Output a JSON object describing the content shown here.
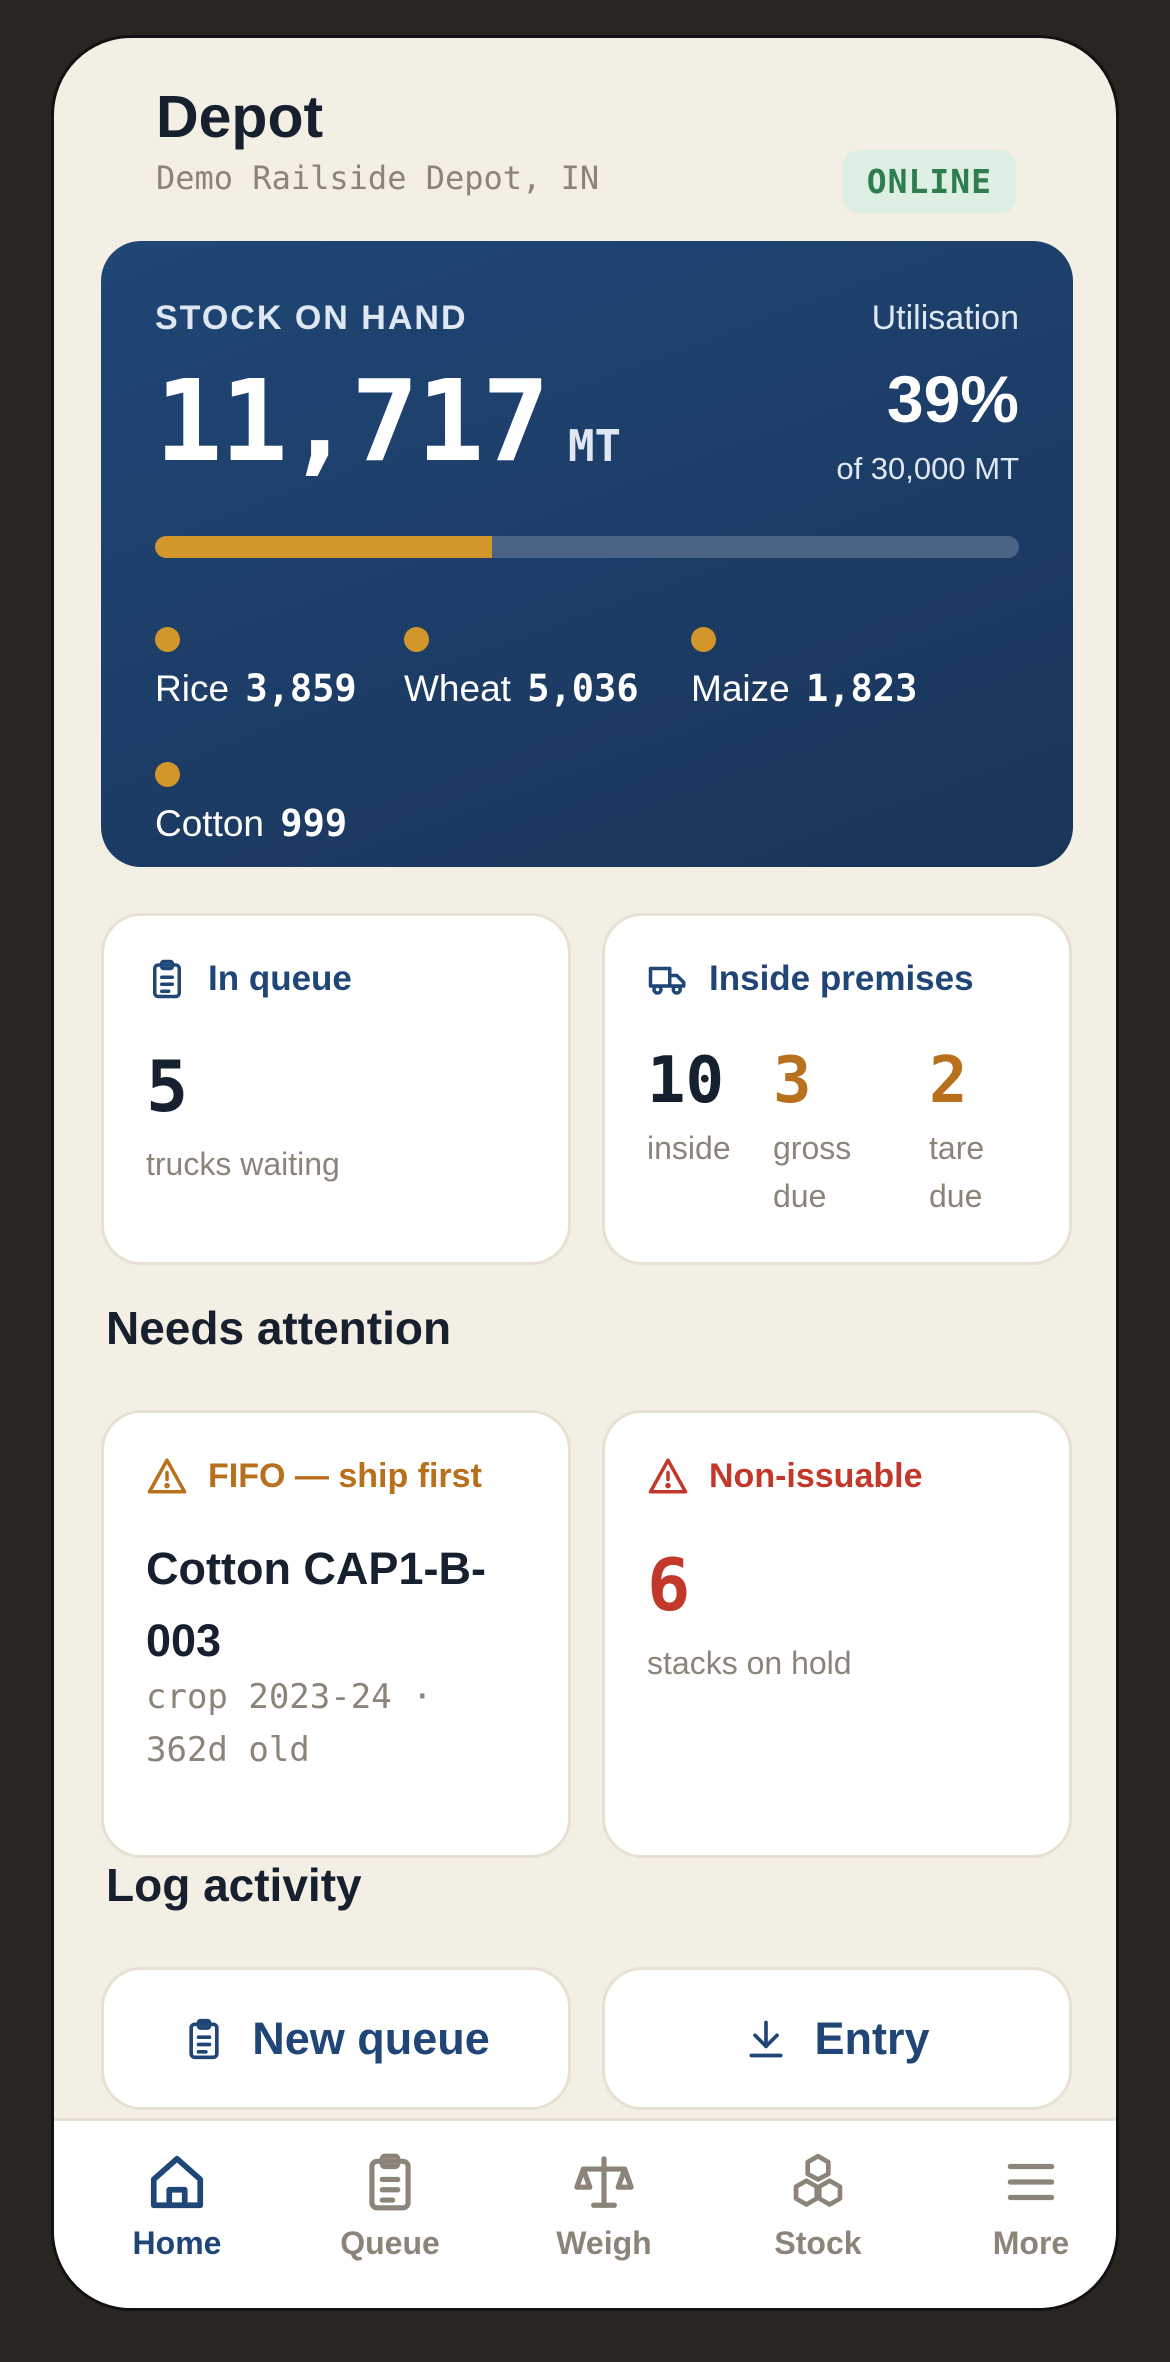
{
  "header": {
    "title": "Depot",
    "subtitle": "Demo Railside Depot, IN",
    "status": "ONLINE"
  },
  "stock": {
    "label": "STOCK ON HAND",
    "value": "11,717",
    "unit": "MT",
    "utilisation_label": "Utilisation",
    "utilisation_value": "39%",
    "utilisation_fraction": 0.39,
    "capacity_text": "of 30,000 MT",
    "crops": [
      {
        "name": "Rice",
        "value": "3,859"
      },
      {
        "name": "Wheat",
        "value": "5,036"
      },
      {
        "name": "Maize",
        "value": "1,823"
      },
      {
        "name": "Cotton",
        "value": "999"
      }
    ]
  },
  "queue_card": {
    "title": "In queue",
    "count": "5",
    "subtitle": "trucks waiting"
  },
  "premises_card": {
    "title": "Inside premises",
    "stats": [
      {
        "value": "10",
        "label": "inside"
      },
      {
        "value": "3",
        "label": "gross due"
      },
      {
        "value": "2",
        "label": "tare due"
      }
    ]
  },
  "attention": {
    "title": "Needs attention",
    "fifo": {
      "label": "FIFO — ship first",
      "title": "Cotton CAP1-B-003",
      "subtitle": "crop 2023-24 · 362d old"
    },
    "non_issuable": {
      "label": "Non-issuable",
      "count": "6",
      "subtitle": "stacks on hold"
    }
  },
  "log": {
    "title": "Log activity",
    "new_queue": "New queue",
    "entry": "Entry"
  },
  "nav": {
    "items": [
      {
        "label": "Home"
      },
      {
        "label": "Queue"
      },
      {
        "label": "Weigh"
      },
      {
        "label": "Stock"
      },
      {
        "label": "More"
      }
    ]
  },
  "colors": {
    "navy": "#1f4676",
    "accent": "#d3962a",
    "danger": "#c2382a",
    "warning": "#b8701c",
    "online": "#2e7d4f"
  }
}
